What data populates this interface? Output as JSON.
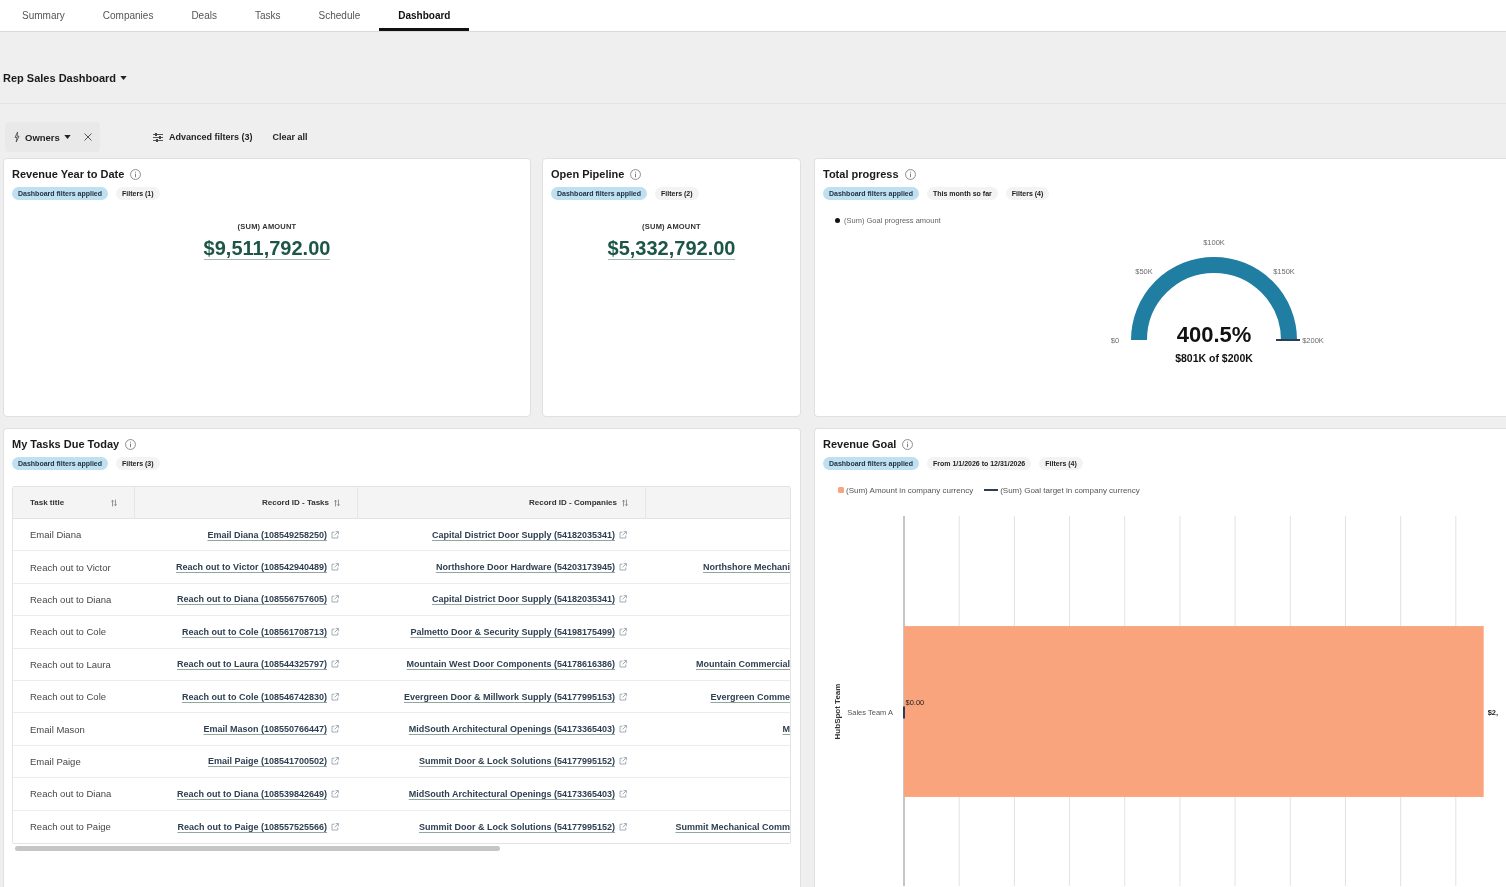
{
  "tabs": [
    {
      "label": "Summary",
      "selected": false
    },
    {
      "label": "Companies",
      "selected": false
    },
    {
      "label": "Deals",
      "selected": false
    },
    {
      "label": "Tasks",
      "selected": false
    },
    {
      "label": "Schedule",
      "selected": false
    },
    {
      "label": "Dashboard",
      "selected": true
    }
  ],
  "dashboard_selector": {
    "label": "Rep Sales Dashboard"
  },
  "filter_bar": {
    "owners": "Owners",
    "advanced_filters": "Advanced filters (3)",
    "clear_all": "Clear all"
  },
  "revenue_year_to_date": {
    "title": "Revenue Year to Date",
    "chips": [
      {
        "label": "Dashboard filters applied",
        "kind": "applied"
      },
      {
        "label": "Filters (1)",
        "kind": "plain"
      }
    ],
    "metric_label": "(SUM) AMOUNT",
    "metric_value": "$9,511,792.00"
  },
  "open_pipeline": {
    "title": "Open Pipeline",
    "chips": [
      {
        "label": "Dashboard filters applied",
        "kind": "applied"
      },
      {
        "label": "Filters (2)",
        "kind": "plain"
      }
    ],
    "metric_label": "(SUM) AMOUNT",
    "metric_value": "$5,332,792.00"
  },
  "total_progress": {
    "title": "Total progress",
    "chips": [
      {
        "label": "Dashboard filters applied",
        "kind": "applied"
      },
      {
        "label": "This month so far",
        "kind": "plain"
      },
      {
        "label": "Filters (4)",
        "kind": "plain"
      }
    ],
    "legend": "(Sum) Goal progress amount",
    "gauge": {
      "tick_labels": [
        "$0",
        "$50K",
        "$100K",
        "$150K",
        "$200K"
      ],
      "percent": "400.5%",
      "summary": "$801K of $200K"
    }
  },
  "my_tasks_due_today": {
    "title": "My Tasks Due Today",
    "chips": [
      {
        "label": "Dashboard filters applied",
        "kind": "applied"
      },
      {
        "label": "Filters (3)",
        "kind": "plain"
      }
    ],
    "table": {
      "columns": [
        {
          "label": "Task title"
        },
        {
          "label": "Record ID - Tasks"
        },
        {
          "label": "Record ID - Companies"
        }
      ],
      "rows": [
        {
          "task_title": "Email Diana",
          "record_id_tasks": "Email Diana (108549258250)",
          "record_id_companies": "Capital District Door Supply (54182035341)"
        },
        {
          "task_title": "Reach out to Victor",
          "record_id_tasks": "Reach out to Victor (108542940489)",
          "record_id_companies": "Northshore Door Hardware (54203173945)",
          "column_4": "Northshore Mechani"
        },
        {
          "task_title": "Reach out to Diana",
          "record_id_tasks": "Reach out to Diana (108556757605)",
          "record_id_companies": "Capital District Door Supply (54182035341)"
        },
        {
          "task_title": "Reach out to Cole",
          "record_id_tasks": "Reach out to Cole (108561708713)",
          "record_id_companies": "Palmetto Door & Security Supply (54198175499)"
        },
        {
          "task_title": "Reach out to Laura",
          "record_id_tasks": "Reach out to Laura (108544325797)",
          "record_id_companies": "Mountain West Door Components (54178616386)",
          "column_4": "Mountain Commercial"
        },
        {
          "task_title": "Reach out to Cole",
          "record_id_tasks": "Reach out to Cole (108546742830)",
          "record_id_companies": "Evergreen Door & Millwork Supply (54177995153)",
          "column_4": "Evergreen Comme"
        },
        {
          "task_title": "Email Mason",
          "record_id_tasks": "Email Mason (108550766447)",
          "record_id_companies": "MidSouth Architectural Openings (54173365403)",
          "column_4": "M"
        },
        {
          "task_title": "Email Paige",
          "record_id_tasks": "Email Paige (108541700502)",
          "record_id_companies": "Summit Door & Lock Solutions (54177995152)"
        },
        {
          "task_title": "Reach out to Diana",
          "record_id_tasks": "Reach out to Diana (108539842649)",
          "record_id_companies": "MidSouth Architectural Openings (54173365403)"
        },
        {
          "task_title": "Reach out to Paige",
          "record_id_tasks": "Reach out to Paige (108557525566)",
          "record_id_companies": "Summit Door & Lock Solutions (54177995152)",
          "column_4": "Summit Mechanical Comm"
        }
      ]
    }
  },
  "revenue_goal": {
    "title": "Revenue Goal",
    "chips": [
      {
        "label": "Dashboard filters applied",
        "kind": "applied"
      },
      {
        "label": "From 1/1/2026 to 12/31/2026",
        "kind": "plain"
      },
      {
        "label": "Filters (4)",
        "kind": "plain"
      }
    ],
    "legend": [
      {
        "label": "(Sum) Amount in company currency",
        "kind": "swatch",
        "color": "#f9a47c"
      },
      {
        "label": "(Sum) Goal target in company currency",
        "kind": "line",
        "color": "#2d3e50"
      }
    ],
    "bar_chart": {
      "axis_title": "HubSpot Team",
      "categories": [
        {
          "label": "Sales Team A",
          "amount_label": "$2,",
          "goal_label": "$0.00"
        }
      ]
    }
  }
}
